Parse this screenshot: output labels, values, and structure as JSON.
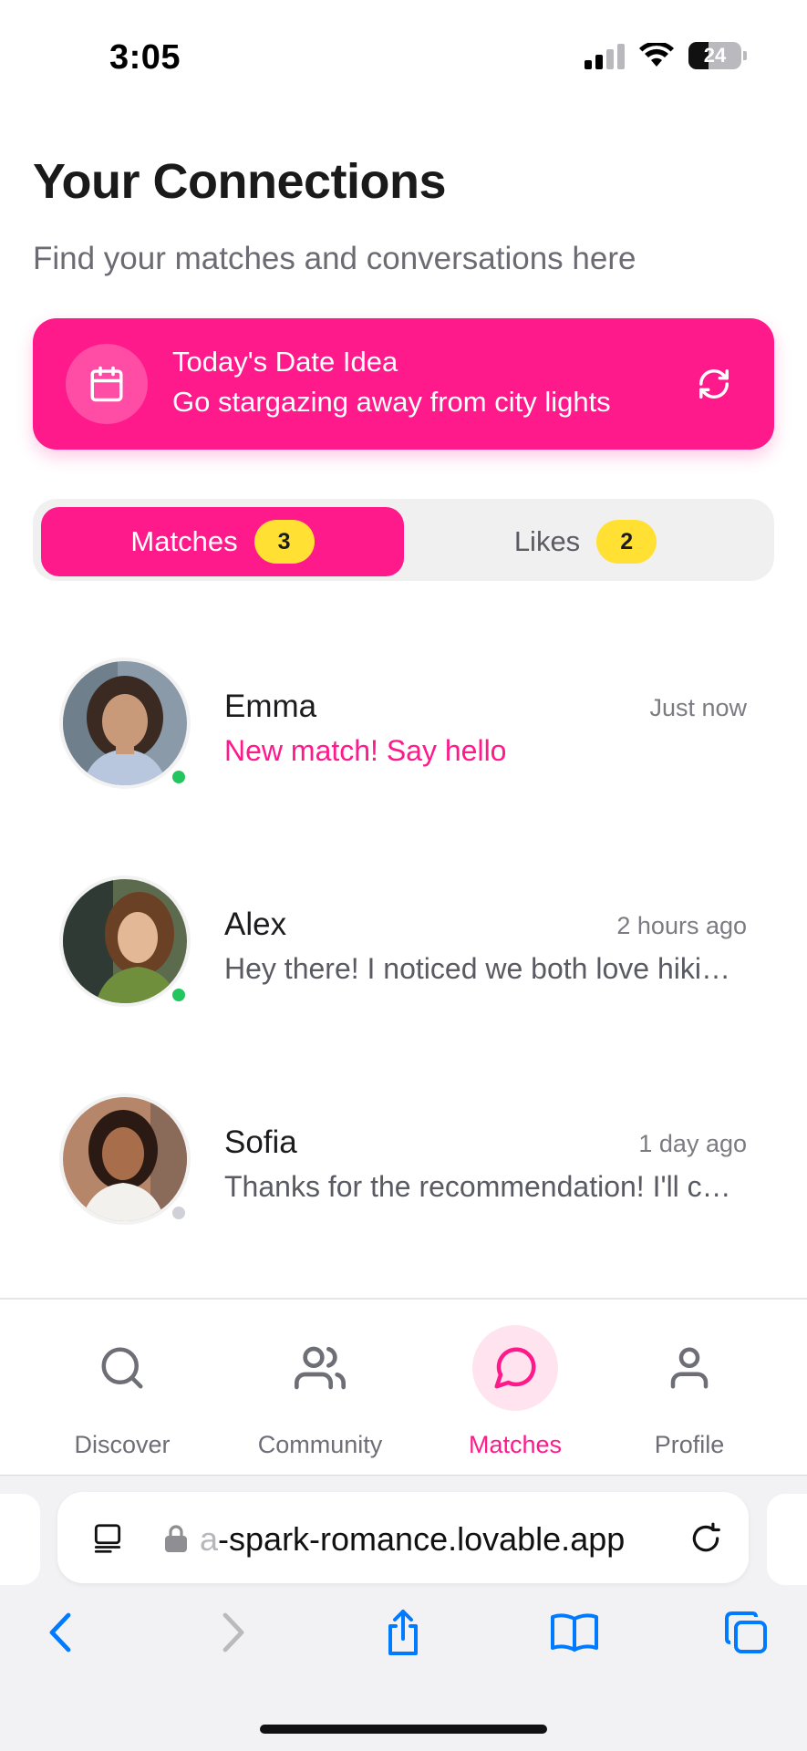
{
  "status_bar": {
    "time": "3:05",
    "battery": "24"
  },
  "header": {
    "title": "Your Connections",
    "subtitle": "Find your matches and conversations here"
  },
  "date_idea": {
    "title": "Today's Date Idea",
    "text": "Go stargazing away from city lights",
    "icon": "calendar-icon",
    "action_icon": "refresh-icon"
  },
  "tabs": [
    {
      "label": "Matches",
      "count": "3",
      "active": true
    },
    {
      "label": "Likes",
      "count": "2",
      "active": false
    }
  ],
  "conversations": [
    {
      "name": "Emma",
      "time": "Just now",
      "message": "New match! Say hello",
      "online": true,
      "highlight": true
    },
    {
      "name": "Alex",
      "time": "2 hours ago",
      "message": "Hey there! I noticed we both love hiki…",
      "online": true,
      "highlight": false
    },
    {
      "name": "Sofia",
      "time": "1 day ago",
      "message": "Thanks for the recommendation! I'll c…",
      "online": false,
      "highlight": false
    }
  ],
  "bottom_nav": [
    {
      "label": "Discover",
      "icon": "search-icon",
      "active": false
    },
    {
      "label": "Community",
      "icon": "users-icon",
      "active": false
    },
    {
      "label": "Matches",
      "icon": "message-circle-icon",
      "active": true
    },
    {
      "label": "Profile",
      "icon": "user-icon",
      "active": false
    }
  ],
  "browser": {
    "url_faded": "a",
    "url": "-spark-romance.lovable.app"
  },
  "colors": {
    "accent": "#ff1a8c",
    "badge": "#ffe033",
    "online": "#22c55e"
  }
}
